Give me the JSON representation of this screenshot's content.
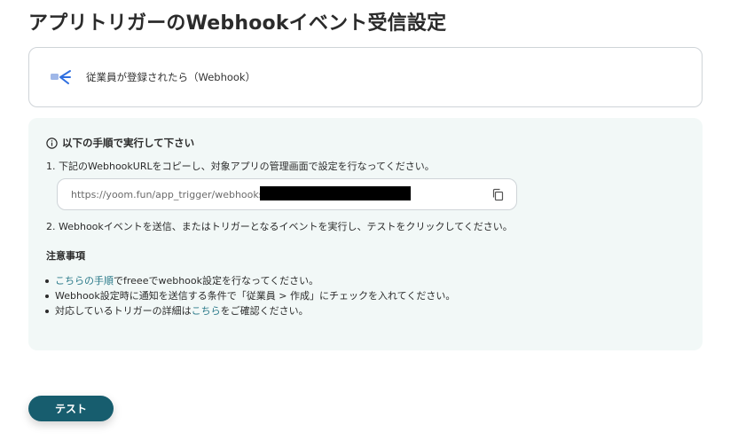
{
  "page": {
    "title": "アプリトリガーのWebhookイベント受信設定"
  },
  "trigger": {
    "label": "従業員が登録されたら（Webhook）",
    "icon": "freee-app-icon"
  },
  "instructions": {
    "heading": "以下の手順で実行して下さい",
    "step1": "1. 下記のWebhookURLをコピーし、対象アプリの管理画面で設定を行なってください。",
    "webhook_url": "https://yoom.fun/app_trigger/webhooks/",
    "step2": "2. Webhookイベントを送信、またはトリガーとなるイベントを実行し、テストをクリックしてください。"
  },
  "notes": {
    "heading": "注意事項",
    "item1": {
      "link": "こちらの手順",
      "text": "でfreeeでwebhook設定を行なってください。"
    },
    "item2": {
      "text": "Webhook設定時に通知を送信する条件で「従業員 > 作成」にチェックを入れてください。"
    },
    "item3": {
      "prefix": "対応しているトリガーの詳細は",
      "link": "こちら",
      "suffix": "をご確認ください。"
    }
  },
  "actions": {
    "test_label": "テスト"
  },
  "colors": {
    "accent": "#175d6e",
    "link": "#2b7a8a",
    "panel_bg": "#f2f8f7"
  }
}
